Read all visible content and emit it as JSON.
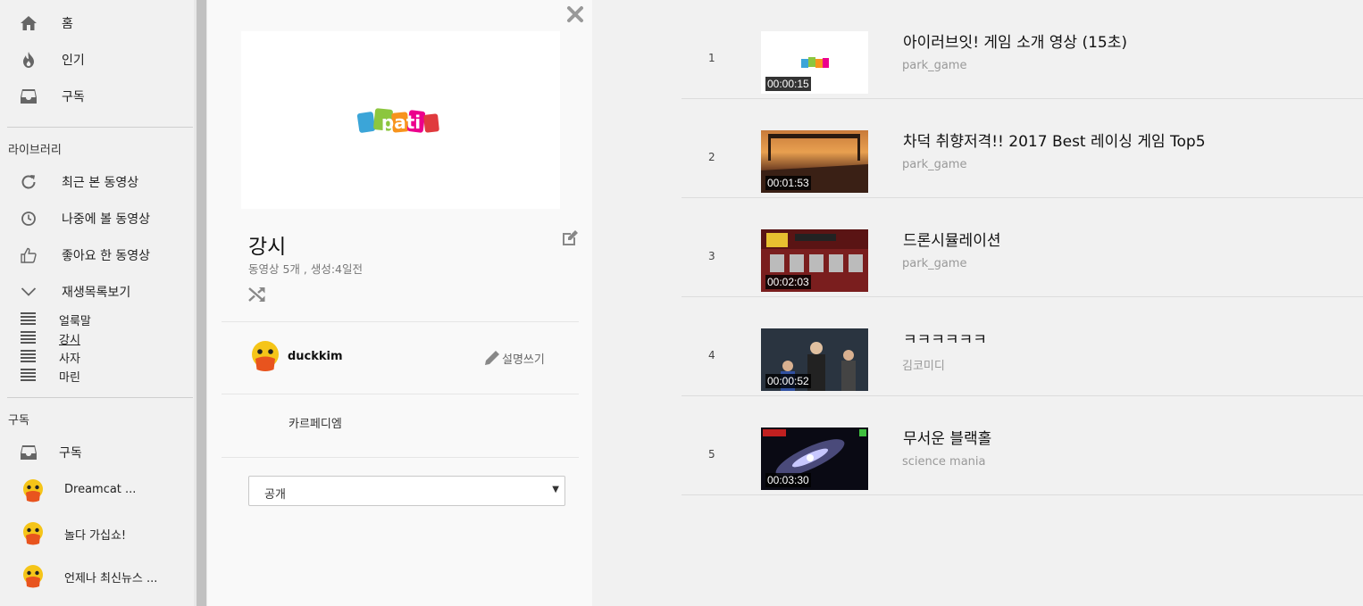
{
  "sidebar": {
    "main": [
      {
        "label": "홈",
        "icon": "home-icon"
      },
      {
        "label": "인기",
        "icon": "flame-icon"
      },
      {
        "label": "구독",
        "icon": "inbox-icon"
      }
    ],
    "library_label": "라이브러리",
    "library": [
      {
        "label": "최근 본 동영상",
        "icon": "history-icon"
      },
      {
        "label": "나중에 볼 동영상",
        "icon": "clock-icon"
      },
      {
        "label": "좋아요 한 동영상",
        "icon": "thumbs-up-icon"
      },
      {
        "label": "재생목록보기",
        "icon": "chevron-down-icon"
      }
    ],
    "playlists": [
      {
        "label": "얼룩말",
        "icon": "playlist-icon"
      },
      {
        "label": "강시",
        "icon": "playlist-icon"
      },
      {
        "label": "사자",
        "icon": "playlist-icon"
      },
      {
        "label": "마린",
        "icon": "playlist-icon"
      }
    ],
    "subs_label": "구독",
    "subs_all": {
      "label": "구독",
      "icon": "inbox-icon"
    },
    "subscriptions": [
      {
        "label": "Dreamcat ..."
      },
      {
        "label": "놀다 가십쇼!"
      },
      {
        "label": "언제나 최신뉴스 ..."
      }
    ]
  },
  "playlist": {
    "cover_logo": "pati",
    "title": "강시",
    "meta": "동영상 5개 , 생성:4일전",
    "owner": "duckkim",
    "write_desc_label": "설명쓰기",
    "description": "카르페디엠",
    "privacy": "공개"
  },
  "videos": [
    {
      "index": "1",
      "title": "아이러브잇! 게임 소개 영상 (15초)",
      "channel": "park_game",
      "duration": "00:00:15"
    },
    {
      "index": "2",
      "title": "차덕 취향저격!! 2017 Best 레이싱 게임 Top5",
      "channel": "park_game",
      "duration": "00:01:53"
    },
    {
      "index": "3",
      "title": "드론시뮬레이션",
      "channel": "park_game",
      "duration": "00:02:03"
    },
    {
      "index": "4",
      "title": "ㅋㅋㅋㅋㅋㅋ",
      "channel": "김코미디",
      "duration": "00:00:52"
    },
    {
      "index": "5",
      "title": "무서운 블랙홀",
      "channel": "science mania",
      "duration": "00:03:30"
    }
  ],
  "colors": {
    "accent": "#f5c518",
    "duck_beak": "#e8541e",
    "muted": "#999999"
  }
}
